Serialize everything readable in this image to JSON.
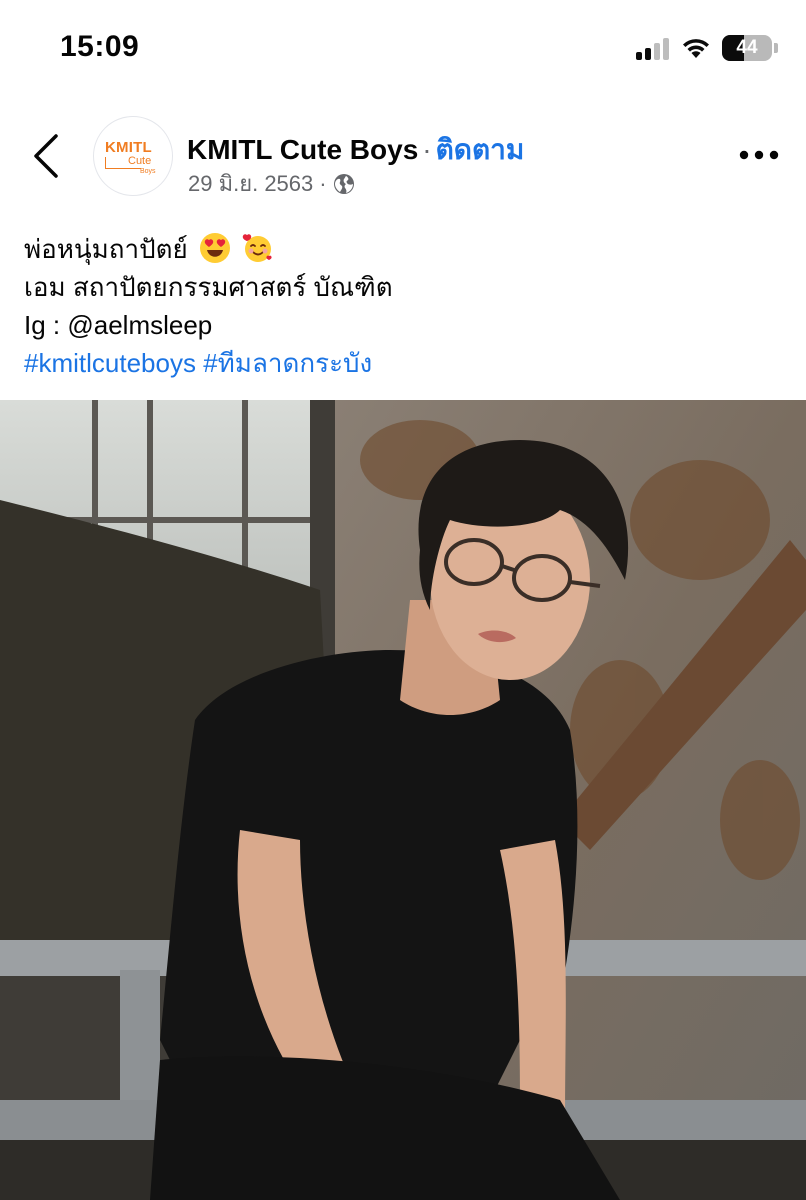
{
  "status_bar": {
    "time": "15:09",
    "battery_level": "44",
    "battery_fraction": 0.44
  },
  "post": {
    "page_name": "KMITL Cute Boys",
    "separator": "·",
    "follow_label": "ติดตาม",
    "date": "29 มิ.ย. 2563",
    "date_separator": "·",
    "privacy_icon": "globe-icon",
    "avatar": {
      "line1": "KMITL",
      "line2": "Cute",
      "line3": "Boys"
    },
    "caption": {
      "line1": "พ่อหนุ่มถาปัตย์",
      "line2": "เอม สถาปัตยกรรมศาสตร์ บัณฑิต",
      "line3": "Ig : @aelmsleep",
      "hashtag1": "#kmitlcuteboys",
      "hashtag2": "#ทีมลาดกระบัง"
    },
    "emojis": [
      "heart-eyes-emoji",
      "smiling-face-with-hearts-emoji"
    ]
  },
  "colors": {
    "link_blue": "#1b74e4",
    "secondary_text": "#65676b",
    "logo_orange": "#f07d22"
  }
}
